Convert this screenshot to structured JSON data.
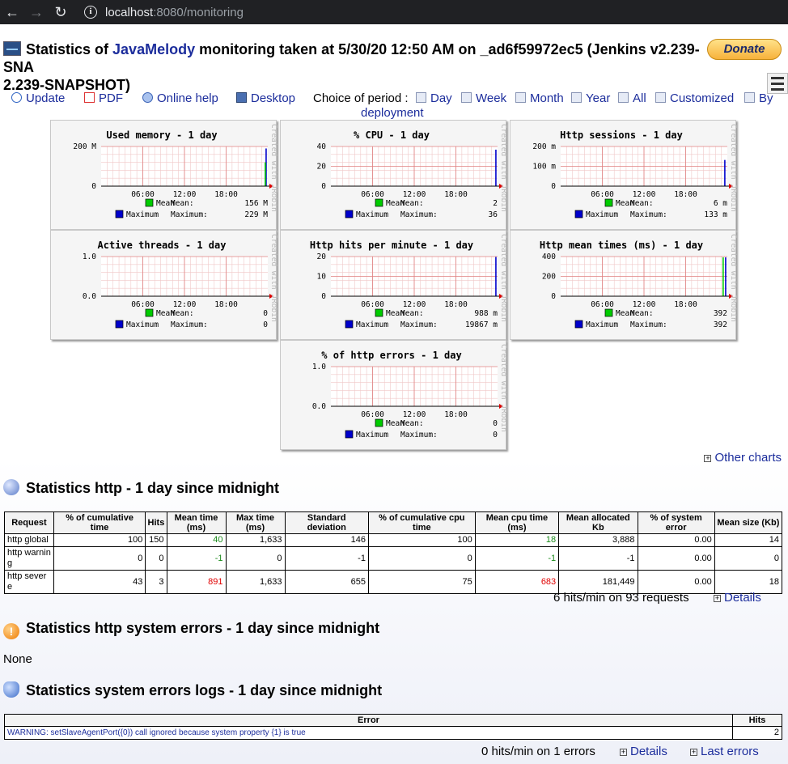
{
  "browser": {
    "url_host": "localhost",
    "url_port": ":8080/monitoring"
  },
  "title": {
    "prefix": "Statistics of ",
    "link": "JavaMelody",
    "suffix": " monitoring taken at 5/30/20 12:50 AM on _ad6f59972ec5 (Jenkins v2.239-SNAPSHOT)",
    "line1_rest": " monitoring taken at 5/30/20 12:50 AM on _ad6f59972ec5 (Jenkins v2.239-SNA",
    "line2": "2.239-SNAPSHOT)"
  },
  "donate_label": "Donate",
  "toolbar": {
    "update": "Update",
    "pdf": "PDF",
    "online_help": "Online help",
    "desktop": "Desktop",
    "period_label": "Choice of period :",
    "day": "Day",
    "week": "Week",
    "month": "Month",
    "year": "Year",
    "all": "All",
    "customized": "Customized",
    "by": "By",
    "deployment": "deployment"
  },
  "chart_data": [
    {
      "type": "bar",
      "title": "Used memory - 1 day",
      "x_ticks": [
        "06:00",
        "12:00",
        "18:00"
      ],
      "y_ticks": [
        "0",
        "200 M"
      ],
      "series": [
        {
          "name": "Mean",
          "label": "Mean:",
          "value_text": "156 M"
        },
        {
          "name": "Maximum",
          "label": "Maximum:",
          "value_text": "229 M"
        }
      ]
    },
    {
      "type": "bar",
      "title": "% CPU - 1 day",
      "x_ticks": [
        "06:00",
        "12:00",
        "18:00"
      ],
      "y_ticks": [
        "0",
        "20",
        "40"
      ],
      "series": [
        {
          "name": "Mean",
          "label": "Mean:",
          "value_text": "2"
        },
        {
          "name": "Maximum",
          "label": "Maximum:",
          "value_text": "36"
        }
      ]
    },
    {
      "type": "bar",
      "title": "Http sessions - 1 day",
      "x_ticks": [
        "06:00",
        "12:00",
        "18:00"
      ],
      "y_ticks": [
        "0",
        "100 m",
        "200 m"
      ],
      "series": [
        {
          "name": "Mean",
          "label": "Mean:",
          "value_text": "6 m"
        },
        {
          "name": "Maximum",
          "label": "Maximum:",
          "value_text": "133 m"
        }
      ]
    },
    {
      "type": "bar",
      "title": "Active threads - 1 day",
      "x_ticks": [
        "06:00",
        "12:00",
        "18:00"
      ],
      "y_ticks": [
        "0.0",
        "1.0"
      ],
      "series": [
        {
          "name": "Mean",
          "label": "Mean:",
          "value_text": "0"
        },
        {
          "name": "Maximum",
          "label": "Maximum:",
          "value_text": "0"
        }
      ]
    },
    {
      "type": "bar",
      "title": "Http hits per minute - 1 day",
      "x_ticks": [
        "06:00",
        "12:00",
        "18:00"
      ],
      "y_ticks": [
        "0",
        "10",
        "20"
      ],
      "series": [
        {
          "name": "Mean",
          "label": "Mean:",
          "value_text": "988 m"
        },
        {
          "name": "Maximum",
          "label": "Maximum:",
          "value_text": "19867 m"
        }
      ]
    },
    {
      "type": "bar",
      "title": "Http mean times (ms) - 1 day",
      "x_ticks": [
        "06:00",
        "12:00",
        "18:00"
      ],
      "y_ticks": [
        "0",
        "200",
        "400"
      ],
      "series": [
        {
          "name": "Mean",
          "label": "Mean:",
          "value_text": "392"
        },
        {
          "name": "Maximum",
          "label": "Maximum:",
          "value_text": "392"
        }
      ]
    },
    {
      "type": "bar",
      "title": "% of http errors - 1 day",
      "x_ticks": [
        "06:00",
        "12:00",
        "18:00"
      ],
      "y_ticks": [
        "0.0",
        "1.0"
      ],
      "series": [
        {
          "name": "Mean",
          "label": "Mean:",
          "value_text": "0"
        },
        {
          "name": "Maximum",
          "label": "Maximum:",
          "value_text": "0"
        }
      ]
    }
  ],
  "chart_watermark": "Created with JRobin",
  "other_charts": "Other charts",
  "http_section": {
    "title": "Statistics http - 1 day since midnight",
    "headers": [
      "Request",
      "% of cumulative time",
      "Hits",
      "Mean time (ms)",
      "Max time (ms)",
      "Standard deviation",
      "% of cumulative cpu time",
      "Mean cpu time (ms)",
      "Mean allocated Kb",
      "% of system error",
      "Mean size (Kb)"
    ],
    "rows": [
      [
        "http global",
        "100",
        "150",
        "40",
        "1,633",
        "146",
        "100",
        "18",
        "3,888",
        "0.00",
        "14"
      ],
      [
        "http warning",
        "0",
        "0",
        "-1",
        "0",
        "-1",
        "0",
        "-1",
        "-1",
        "0.00",
        "0"
      ],
      [
        "http severe",
        "43",
        "3",
        "891",
        "1,633",
        "655",
        "75",
        "683",
        "181,449",
        "0.00",
        "18"
      ]
    ],
    "summary": "6 hits/min on 93 requests",
    "details": "Details"
  },
  "system_errors_section": {
    "title": "Statistics http system errors - 1 day since midnight",
    "content": "None"
  },
  "logs_section": {
    "title": "Statistics system errors logs - 1 day since midnight",
    "headers": [
      "Error",
      "Hits"
    ],
    "rows": [
      [
        "WARNING: setSlaveAgentPort({0}) call ignored because system property {1} is true",
        "2"
      ]
    ],
    "summary": "0 hits/min on 1 errors",
    "details": "Details",
    "last_errors": "Last errors"
  },
  "colors": {
    "mean": "#00cc00",
    "maximum": "#0000cc",
    "link": "#1c2d9c",
    "good": "#1a8a1a",
    "bad": "#e00000"
  }
}
